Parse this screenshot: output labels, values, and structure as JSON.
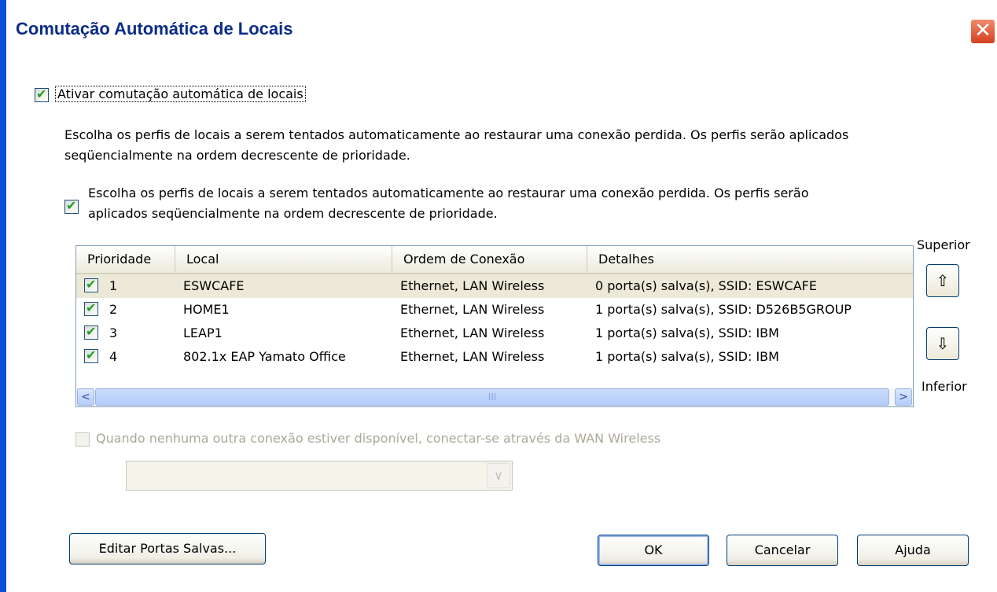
{
  "window": {
    "title": "Comutação Automática de Locais",
    "close_glyph": "✕"
  },
  "enable_switching": {
    "checked": true,
    "label": "Ativar comutação automática de locais"
  },
  "description": [
    "Escolha os perfis de locais a serem tentados automaticamente ao restaurar uma conexão perdida. Os perfis serão aplicados",
    "seqüencialmente na ordem decrescente de prioridade."
  ],
  "sequential_option": {
    "checked": true,
    "lines": [
      "Escolha os perfis de locais a serem tentados automaticamente ao restaurar uma conexão perdida. Os perfis serão",
      "aplicados seqüencialmente na ordem decrescente de prioridade."
    ]
  },
  "profile_list": {
    "columns": [
      "Prioridade",
      "Local",
      "Ordem de Conexão",
      "Detalhes"
    ],
    "rows": [
      {
        "checked": true,
        "priority": "1",
        "location": "ESWCAFE",
        "order": "Ethernet, LAN Wireless",
        "details": "0 porta(s) salva(s),  SSID: ESWCAFE",
        "selected": true
      },
      {
        "checked": true,
        "priority": "2",
        "location": "HOME1",
        "order": "Ethernet, LAN Wireless",
        "details": "1 porta(s) salva(s),  SSID: D526B5GROUP",
        "selected": false
      },
      {
        "checked": true,
        "priority": "3",
        "location": "LEAP1",
        "order": "Ethernet, LAN Wireless",
        "details": "1 porta(s) salva(s),  SSID: IBM",
        "selected": false
      },
      {
        "checked": true,
        "priority": "4",
        "location": "802.1x EAP Yamato Office",
        "order": "Ethernet, LAN Wireless",
        "details": "1 porta(s) salva(s),  SSID: IBM",
        "selected": false
      }
    ],
    "scroll_left_glyph": "<",
    "scroll_right_glyph": ">",
    "scroll_thumb_grip": "III"
  },
  "priority_controls": {
    "up_label": "Superior",
    "up_glyph": "⇧",
    "down_label": "Inferior",
    "down_glyph": "⇩"
  },
  "wan_option": {
    "checked": false,
    "enabled": false,
    "label": "Quando nenhuma outra conexão estiver disponível, conectar-se através da WAN Wireless"
  },
  "wan_combo": {
    "value": "",
    "arrow_glyph": "∨"
  },
  "buttons": {
    "edit_ports": "Editar Portas Salvas...",
    "ok": "OK",
    "cancel": "Cancelar",
    "help": "Ajuda"
  }
}
